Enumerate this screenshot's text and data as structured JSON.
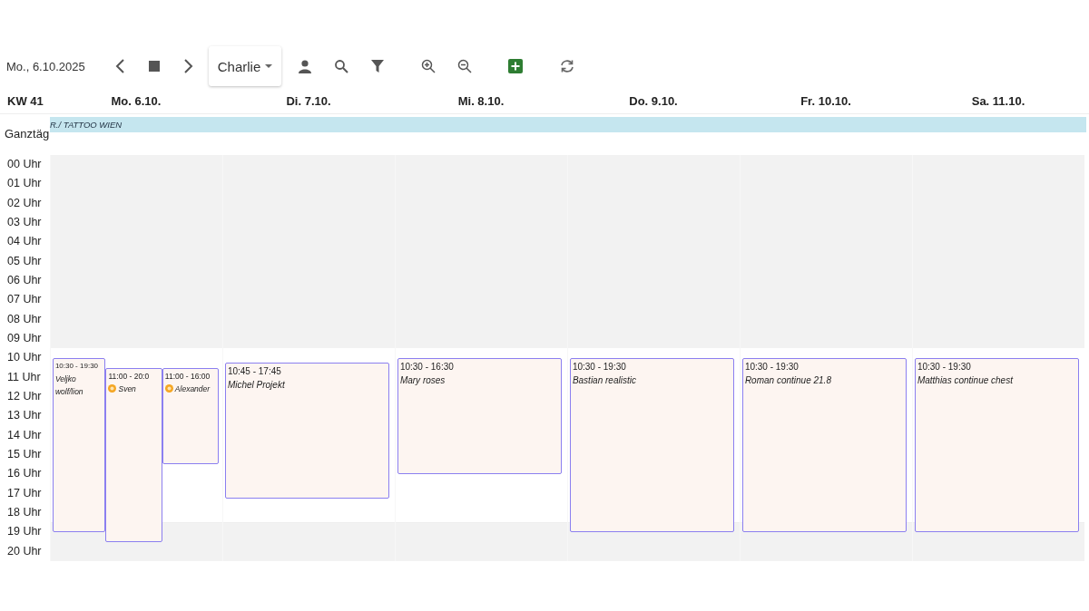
{
  "toolbar": {
    "date": "Mo., 6.10.2025",
    "user_select": {
      "value": "Charlie"
    }
  },
  "week_label": "KW 41",
  "all_day": {
    "label": "Ganztäg",
    "events": [
      {
        "title": "R./ TATTOO WIEN",
        "color": "#c5e6ef"
      }
    ]
  },
  "hours": [
    "00 Uhr",
    "01 Uhr",
    "02 Uhr",
    "03 Uhr",
    "04 Uhr",
    "05 Uhr",
    "06 Uhr",
    "07 Uhr",
    "08 Uhr",
    "09 Uhr",
    "10 Uhr",
    "11 Uhr",
    "12 Uhr",
    "13 Uhr",
    "14 Uhr",
    "15 Uhr",
    "16 Uhr",
    "17 Uhr",
    "18 Uhr",
    "19 Uhr",
    "20 Uhr"
  ],
  "days": [
    {
      "label": "Mo. 6.10.",
      "events": [
        {
          "time": "10:30 - 19:30",
          "title": "Veljko wolf/lion",
          "flagged": false
        },
        {
          "time": "11:00 - 20:0",
          "title": "Sven",
          "flagged": true
        },
        {
          "time": "11:00 - 16:00",
          "title": "Alexander",
          "flagged": true
        }
      ]
    },
    {
      "label": "Di. 7.10.",
      "events": [
        {
          "time": "10:45 - 17:45",
          "title": "Michel Projekt",
          "flagged": false
        }
      ]
    },
    {
      "label": "Mi. 8.10.",
      "events": [
        {
          "time": "10:30 - 16:30",
          "title": "Mary roses",
          "flagged": false
        }
      ]
    },
    {
      "label": "Do. 9.10.",
      "events": [
        {
          "time": "10:30 - 19:30",
          "title": "Bastian realistic",
          "flagged": false
        }
      ]
    },
    {
      "label": "Fr. 10.10.",
      "events": [
        {
          "time": "10:30 - 19:30",
          "title": "Roman continue 21.8",
          "flagged": false
        }
      ]
    },
    {
      "label": "Sa. 11.10.",
      "events": [
        {
          "time": "10:30 - 19:30",
          "title": "Matthias continue chest",
          "flagged": false
        }
      ]
    }
  ]
}
